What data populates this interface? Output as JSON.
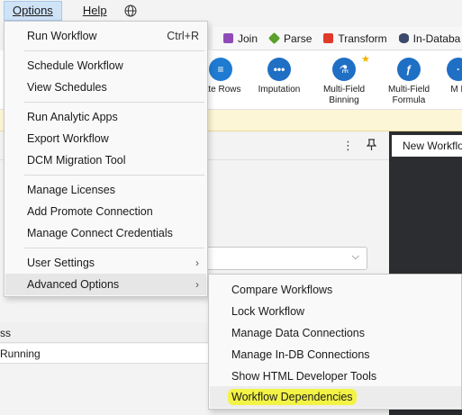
{
  "menubar": {
    "options_label": "Options",
    "help_label": "Help",
    "globe_icon": "globe-icon"
  },
  "categories": [
    {
      "label": "Join",
      "color": "#8e4bb8"
    },
    {
      "label": "Parse",
      "color": "#5aa02c"
    },
    {
      "label": "Transform",
      "color": "#e23a2a"
    },
    {
      "label": "In-Databa",
      "color": "#3b4a6b"
    }
  ],
  "tools": [
    {
      "label": "rate Rows",
      "color": "#1f7bd1"
    },
    {
      "label": "Imputation",
      "color": "#1f6fc5"
    },
    {
      "label": "Multi-Field Binning",
      "color": "#1f6fc5"
    },
    {
      "label": "Multi-Field Formula",
      "color": "#1f6fc5"
    },
    {
      "label": "M F",
      "color": "#1f6fc5"
    }
  ],
  "left_pane": {
    "row_header": "ss",
    "row_value": "Running"
  },
  "right_pane": {
    "tab_label": "New Workflo"
  },
  "options_menu": {
    "items": [
      {
        "label": "Run Workflow",
        "shortcut": "Ctrl+R"
      },
      {
        "label": "Schedule Workflow"
      },
      {
        "label": "View Schedules"
      },
      {
        "label": "Run Analytic Apps"
      },
      {
        "label": "Export Workflow"
      },
      {
        "label": "DCM Migration Tool"
      },
      {
        "label": "Manage Licenses"
      },
      {
        "label": "Add Promote Connection"
      },
      {
        "label": "Manage Connect Credentials"
      },
      {
        "label": "User Settings",
        "arrow": "›"
      },
      {
        "label": "Advanced Options",
        "arrow": "›"
      }
    ]
  },
  "advanced_submenu": {
    "items": [
      {
        "label": "Compare Workflows"
      },
      {
        "label": "Lock Workflow"
      },
      {
        "label": "Manage Data Connections"
      },
      {
        "label": "Manage In-DB Connections"
      },
      {
        "label": "Show HTML Developer Tools"
      },
      {
        "label": "Workflow Dependencies"
      }
    ],
    "highlight_color": "#f3f346"
  }
}
